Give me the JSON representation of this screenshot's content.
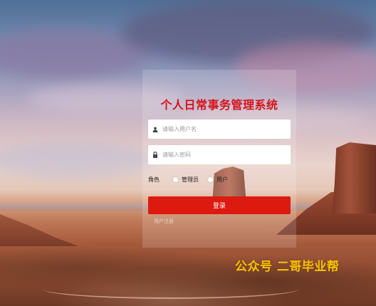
{
  "login": {
    "title": "个人日常事务管理系统",
    "username": {
      "placeholder": "请输入用户名",
      "value": "",
      "icon": "user-icon"
    },
    "password": {
      "placeholder": "请输入密码",
      "value": "",
      "icon": "lock-icon"
    },
    "role": {
      "label": "角色",
      "options": [
        {
          "label": "管理员",
          "selected": false
        },
        {
          "label": "用户",
          "selected": false
        }
      ]
    },
    "submit_label": "登录",
    "register_label": "用户注册"
  },
  "watermark": "公众号 二哥毕业帮",
  "colors": {
    "title": "#d8121a",
    "button": "#dc1a10",
    "watermark": "#f2c200"
  }
}
